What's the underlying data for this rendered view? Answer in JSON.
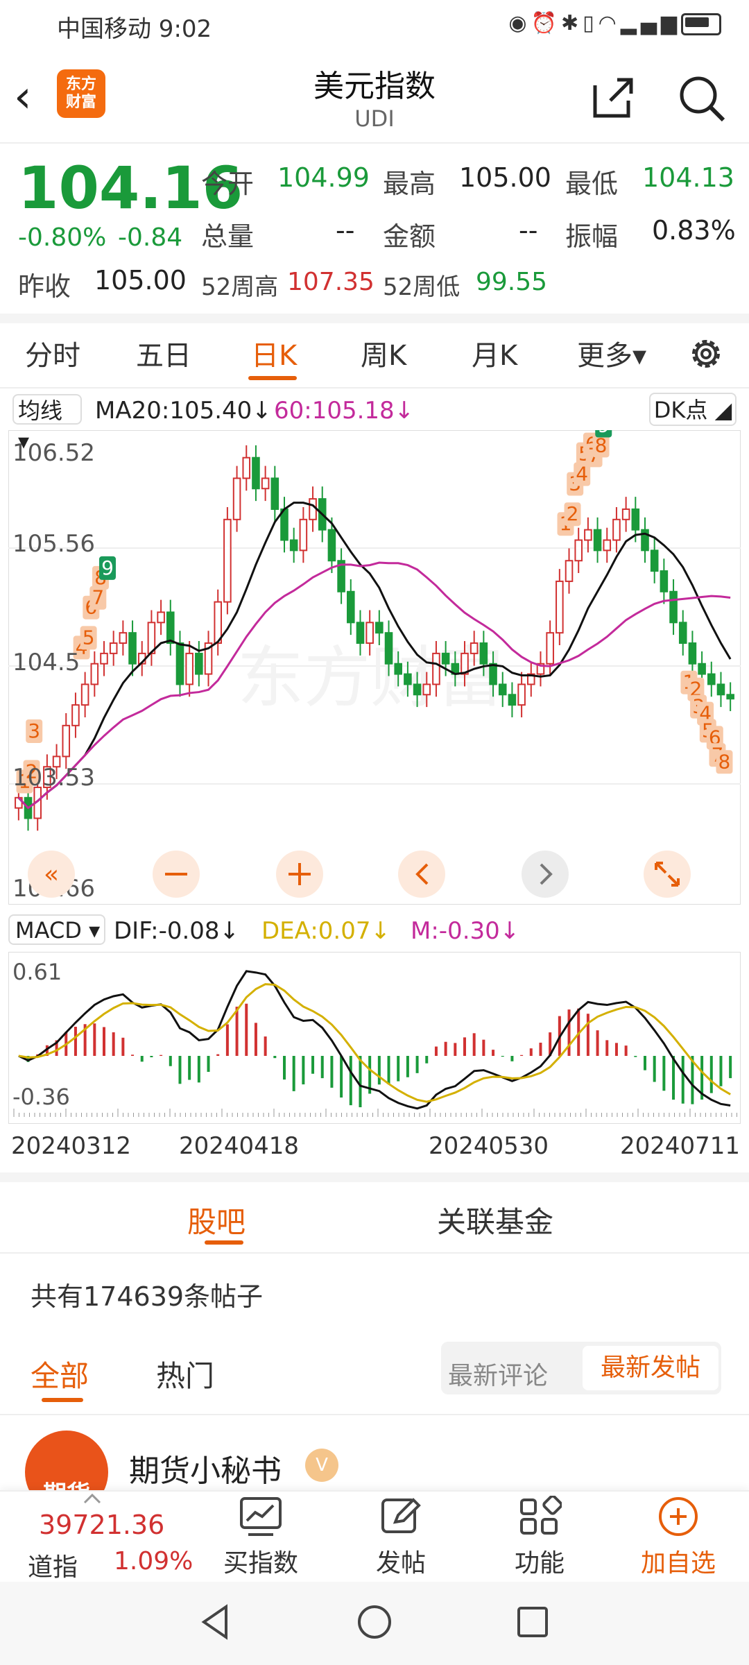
{
  "status_bar": {
    "carrier_time": "中国移动 9:02"
  },
  "header": {
    "logo_line1": "东方",
    "logo_line2": "财富",
    "title": "美元指数",
    "subtitle": "UDI"
  },
  "quote": {
    "price": "104.16",
    "change_pct": "-0.80%",
    "change": "-0.84",
    "prev_close_label": "昨收",
    "prev_close": "105.00",
    "open_label": "今开",
    "open": "104.99",
    "high_label": "最高",
    "high": "105.00",
    "low_label": "最低",
    "low": "104.13",
    "volume_label": "总量",
    "volume": "--",
    "amount_label": "金额",
    "amount": "--",
    "amplitude_label": "振幅",
    "amplitude": "0.83%",
    "wk52_high_label": "52周高",
    "wk52_high": "107.35",
    "wk52_low_label": "52周低",
    "wk52_low": "99.55"
  },
  "tabs": [
    {
      "label": "分时"
    },
    {
      "label": "五日"
    },
    {
      "label": "日K"
    },
    {
      "label": "周K"
    },
    {
      "label": "月K"
    },
    {
      "label": "更多▾"
    }
  ],
  "indicator_bar": {
    "ma_select": "均线 ▾",
    "ma20": "MA20:105.40↓",
    "ma60": "60:105.18↓",
    "dk": "DK点 ◢"
  },
  "macd_bar": {
    "select": "MACD ▾",
    "dif": "DIF:-0.08↓",
    "dea": "DEA:0.07↓",
    "m": "M:-0.30↓"
  },
  "chart_data": [
    {
      "type": "candlestick",
      "y_ticks": [
        "106.52",
        "105.56",
        "104.5",
        "103.53",
        "102.66"
      ],
      "ylim": [
        102.66,
        106.7
      ],
      "closes": [
        103.2,
        103.0,
        103.3,
        103.5,
        103.6,
        103.9,
        104.1,
        104.3,
        104.5,
        104.6,
        104.7,
        104.8,
        104.5,
        104.6,
        104.9,
        105.0,
        104.7,
        104.3,
        104.6,
        104.4,
        104.7,
        105.1,
        105.9,
        106.3,
        106.5,
        106.2,
        106.3,
        106.0,
        105.7,
        105.6,
        105.9,
        106.1,
        105.8,
        105.5,
        105.2,
        104.9,
        104.7,
        104.9,
        104.8,
        104.5,
        104.4,
        104.3,
        104.2,
        104.3,
        104.6,
        104.5,
        104.4,
        104.6,
        104.7,
        104.5,
        104.3,
        104.2,
        104.1,
        104.3,
        104.4,
        104.5,
        104.8,
        105.3,
        105.5,
        105.7,
        105.8,
        105.6,
        105.7,
        105.9,
        106.0,
        105.8,
        105.6,
        105.4,
        105.2,
        104.9,
        104.7,
        104.5,
        104.4,
        104.3,
        104.2,
        104.16
      ],
      "annotations": [
        "1",
        "2",
        "3",
        "4",
        "5",
        "6",
        "7",
        "8",
        "9"
      ],
      "series": [
        {
          "name": "MA20"
        },
        {
          "name": "60"
        }
      ]
    },
    {
      "type": "macd",
      "y_ticks": [
        "0.61",
        "-0.36"
      ],
      "ylim": [
        -0.36,
        0.61
      ],
      "x_ticks": [
        "20240312",
        "20240418",
        "20240530",
        "20240711"
      ]
    }
  ],
  "forum": {
    "tab_guba": "股吧",
    "tab_fund": "关联基金",
    "post_count": "共有174639条帖子",
    "sub_all": "全部",
    "sub_hot": "热门",
    "sort_comment": "最新评论",
    "sort_post": "最新发帖",
    "author": "期货小秘书",
    "avatar_text": "期货"
  },
  "bottom_nav": {
    "index_value": "39721.36",
    "index_name": "道指",
    "index_pct": "1.09%",
    "buy": "买指数",
    "post": "发帖",
    "func": "功能",
    "add": "加自选"
  },
  "colors": {
    "up": "#d13131",
    "down": "#1a9a3a",
    "accent": "#e65e0a",
    "ma60": "#c32a9b",
    "dea": "#d4b000"
  }
}
